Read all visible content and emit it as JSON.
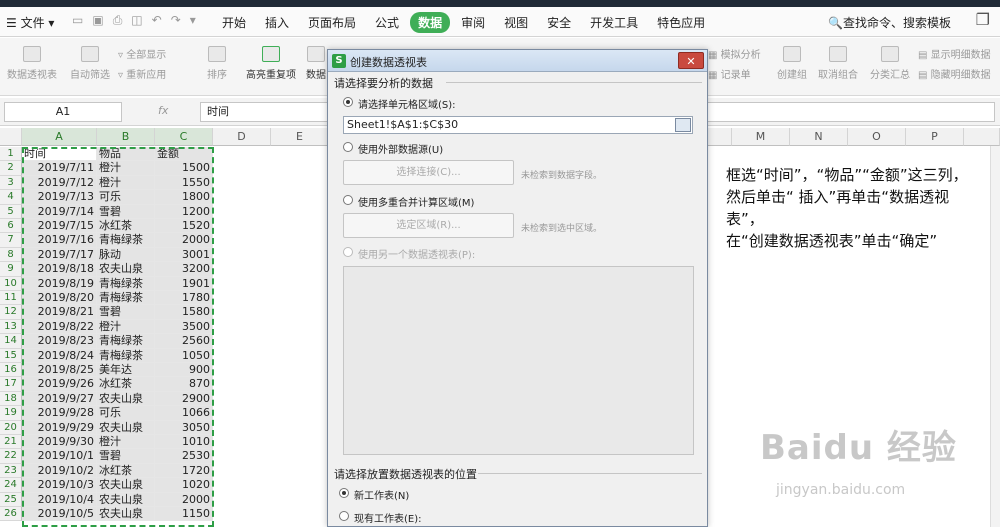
{
  "app": {
    "file_menu": "文件",
    "tabs": [
      "开始",
      "插入",
      "页面布局",
      "公式",
      "数据",
      "审阅",
      "视图",
      "安全",
      "开发工具",
      "特色应用"
    ],
    "active_tab": "数据",
    "search_label": "查找命令、搜索模板",
    "accent": "#3fae57"
  },
  "ribbon": {
    "pivot": "数据透视表",
    "auto_filter": "自动筛选",
    "show_all": "全部显示",
    "reapply": "重新应用",
    "sort": "排序",
    "highlight_dup": "高亮重复项",
    "data_label": "数据",
    "simulate": "模拟分析",
    "record": "记录单",
    "create_group": "创建组",
    "ungroup": "取消组合",
    "subtotal": "分类汇总",
    "show_detail": "显示明细数据",
    "hide_detail": "隐藏明细数据"
  },
  "formula_bar": {
    "name_box": "A1",
    "fx": "fx",
    "content": "时间"
  },
  "columns": [
    "A",
    "B",
    "C",
    "D",
    "E",
    "M",
    "N",
    "O",
    "P"
  ],
  "rows": [
    [
      "时间",
      "物品",
      "金额"
    ],
    [
      "2019/7/11",
      "橙汁",
      "1500"
    ],
    [
      "2019/7/12",
      "橙汁",
      "1550"
    ],
    [
      "2019/7/13",
      "可乐",
      "1800"
    ],
    [
      "2019/7/14",
      "雪碧",
      "1200"
    ],
    [
      "2019/7/15",
      "冰红茶",
      "1520"
    ],
    [
      "2019/7/16",
      "青梅绿茶",
      "2000"
    ],
    [
      "2019/7/17",
      "脉动",
      "3001"
    ],
    [
      "2019/8/18",
      "农夫山泉",
      "3200"
    ],
    [
      "2019/8/19",
      "青梅绿茶",
      "1901"
    ],
    [
      "2019/8/20",
      "青梅绿茶",
      "1780"
    ],
    [
      "2019/8/21",
      "雪碧",
      "1580"
    ],
    [
      "2019/8/22",
      "橙汁",
      "3500"
    ],
    [
      "2019/8/23",
      "青梅绿茶",
      "2560"
    ],
    [
      "2019/8/24",
      "青梅绿茶",
      "1050"
    ],
    [
      "2019/8/25",
      "美年达",
      "900"
    ],
    [
      "2019/9/26",
      "冰红茶",
      "870"
    ],
    [
      "2019/9/27",
      "农夫山泉",
      "2900"
    ],
    [
      "2019/9/28",
      "可乐",
      "1066"
    ],
    [
      "2019/9/29",
      "农夫山泉",
      "3050"
    ],
    [
      "2019/9/30",
      "橙汁",
      "1010"
    ],
    [
      "2019/10/1",
      "雪碧",
      "2530"
    ],
    [
      "2019/10/2",
      "冰红茶",
      "1720"
    ],
    [
      "2019/10/3",
      "农夫山泉",
      "1020"
    ],
    [
      "2019/10/4",
      "农夫山泉",
      "2000"
    ],
    [
      "2019/10/5",
      "农夫山泉",
      "1150"
    ]
  ],
  "row_numbers": [
    "1",
    "2",
    "3",
    "4",
    "5",
    "6",
    "7",
    "8",
    "9",
    "10",
    "11",
    "12",
    "13",
    "14",
    "15",
    "16",
    "17",
    "18",
    "19",
    "20",
    "21",
    "22",
    "23",
    "24",
    "25",
    "26"
  ],
  "dialog": {
    "title": "创建数据透视表",
    "section1": "请选择要分析的数据",
    "opt_range": "请选择单元格区域(S):",
    "range_value": "Sheet1!$A$1:$C$30",
    "opt_external": "使用外部数据源(U)",
    "btn_connect": "选择连接(C)...",
    "hint_connect": "未检索到数据字段。",
    "opt_multi": "使用多重合并计算区域(M)",
    "btn_select": "选定区域(R)...",
    "hint_select": "未检索到选中区域。",
    "opt_other": "使用另一个数据透视表(P):",
    "section2": "请选择放置数据透视表的位置",
    "opt_new": "新工作表(N)",
    "opt_existing": "现有工作表(E):",
    "close": "✕"
  },
  "note": {
    "line1": "框选“时间”，“物品”“金额”这三列，然后单击“ 插入”再单击“数据透视表”，",
    "line2": "在“创建数据透视表”单击“确定”"
  },
  "watermark": {
    "brand": "Baidu 经验",
    "url": "jingyan.baidu.com"
  }
}
